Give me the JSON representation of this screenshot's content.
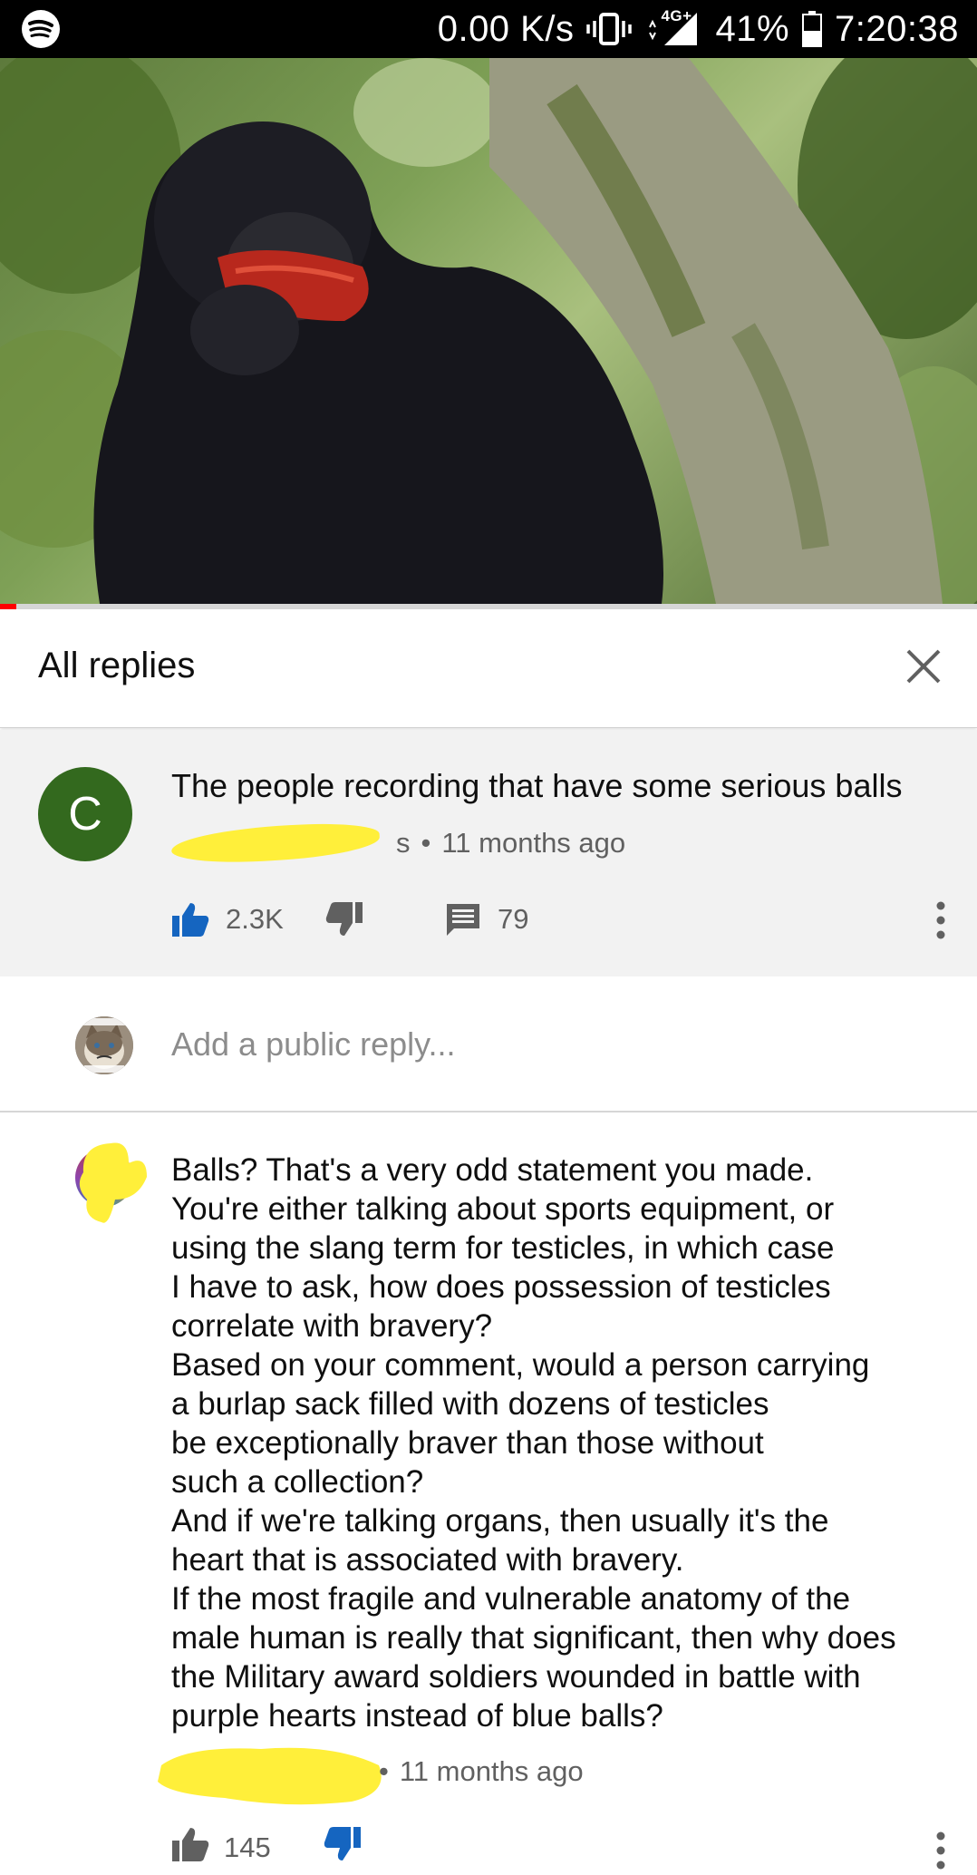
{
  "status_bar": {
    "net_speed": "0.00 K/s",
    "network": "4G+",
    "battery": "41%",
    "time": "7:20:38"
  },
  "video": {
    "progress": 0.017
  },
  "replies_header": {
    "title": "All replies"
  },
  "parent_comment": {
    "avatar_letter": "C",
    "avatar_color": "#33691e",
    "text": "The people recording that have some serious balls",
    "author_suffix": "s",
    "time_ago": "11 months ago",
    "likes": "2.3K",
    "reply_count": "79"
  },
  "add_reply": {
    "placeholder": "Add a public reply..."
  },
  "reply": {
    "lines": [
      "Balls? That's a very odd statement you made.",
      "You're either talking about sports equipment, or",
      "using the slang term for testicles, in which case",
      "I have to ask, how does possession of testicles",
      "correlate with bravery?",
      "Based on your comment, would a person carrying",
      "a burlap sack filled with dozens of testicles",
      "be exceptionally braver than those without",
      "such a collection?",
      "And if we're talking organs, then usually it's the",
      "heart that is associated with bravery.",
      "If the most fragile and vulnerable anatomy of the",
      "male human is really that significant, then why does",
      "the Military award soldiers wounded in battle with",
      "purple hearts instead of blue balls?"
    ],
    "time_ago": "11 months ago",
    "likes": "145"
  },
  "colors": {
    "accent_blue": "#1565c0",
    "redaction_yellow": "#ffef3a",
    "progress_red": "#ff0000"
  },
  "icons": {
    "spotify": "spotify-icon",
    "vibrate": "vibrate-icon",
    "signal": "signal-icon",
    "battery": "battery-icon",
    "close": "close-icon",
    "like": "thumbs-up-icon",
    "dislike": "thumbs-down-icon",
    "comment": "comment-icon",
    "more": "more-vert-icon"
  }
}
